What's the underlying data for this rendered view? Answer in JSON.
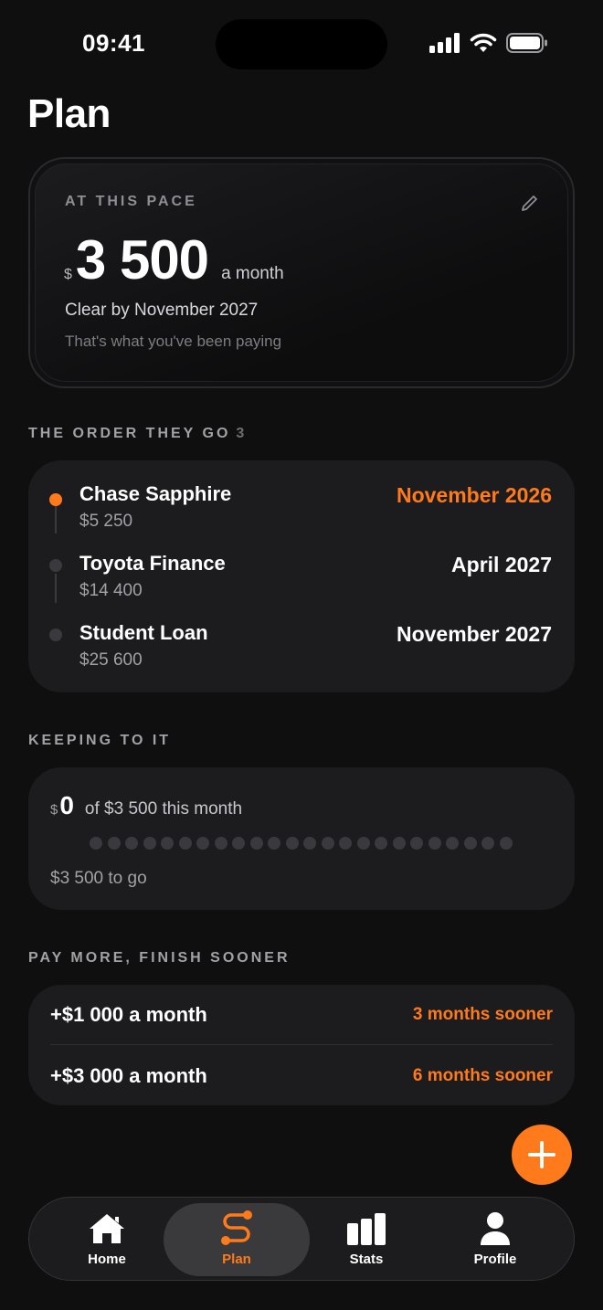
{
  "status_bar": {
    "time": "09:41"
  },
  "page": {
    "title": "Plan"
  },
  "pace": {
    "label": "AT THIS PACE",
    "currency": "$",
    "amount": "3 500",
    "unit": "a month",
    "clear_by": "Clear by November 2027",
    "note": "That's what you've been paying"
  },
  "order": {
    "header": "THE ORDER THEY GO",
    "count": "3",
    "debts": [
      {
        "name": "Chase Sapphire",
        "amount": "$5 250",
        "date": "November 2026",
        "active": true
      },
      {
        "name": "Toyota Finance",
        "amount": "$14 400",
        "date": "April 2027",
        "active": false
      },
      {
        "name": "Student Loan",
        "amount": "$25 600",
        "date": "November 2027",
        "active": false
      }
    ]
  },
  "keeping": {
    "header": "KEEPING TO IT",
    "currency": "$",
    "paid": "0",
    "of_text": "of $3 500 this month",
    "to_go": "$3 500 to go",
    "progress": 0
  },
  "pay_more": {
    "header": "PAY MORE, FINISH SOONER",
    "options": [
      {
        "label": "+$1 000 a month",
        "result": "3 months sooner"
      },
      {
        "label": "+$3 000 a month",
        "result": "6 months sooner"
      }
    ]
  },
  "tabs": [
    {
      "label": "Home",
      "icon": "home-icon",
      "active": false
    },
    {
      "label": "Plan",
      "icon": "route-icon",
      "active": true
    },
    {
      "label": "Stats",
      "icon": "bar-chart-icon",
      "active": false
    },
    {
      "label": "Profile",
      "icon": "person-icon",
      "active": false
    }
  ],
  "colors": {
    "accent": "#ff7a1a",
    "background": "#0f0f10",
    "card": "#1c1c1e"
  }
}
